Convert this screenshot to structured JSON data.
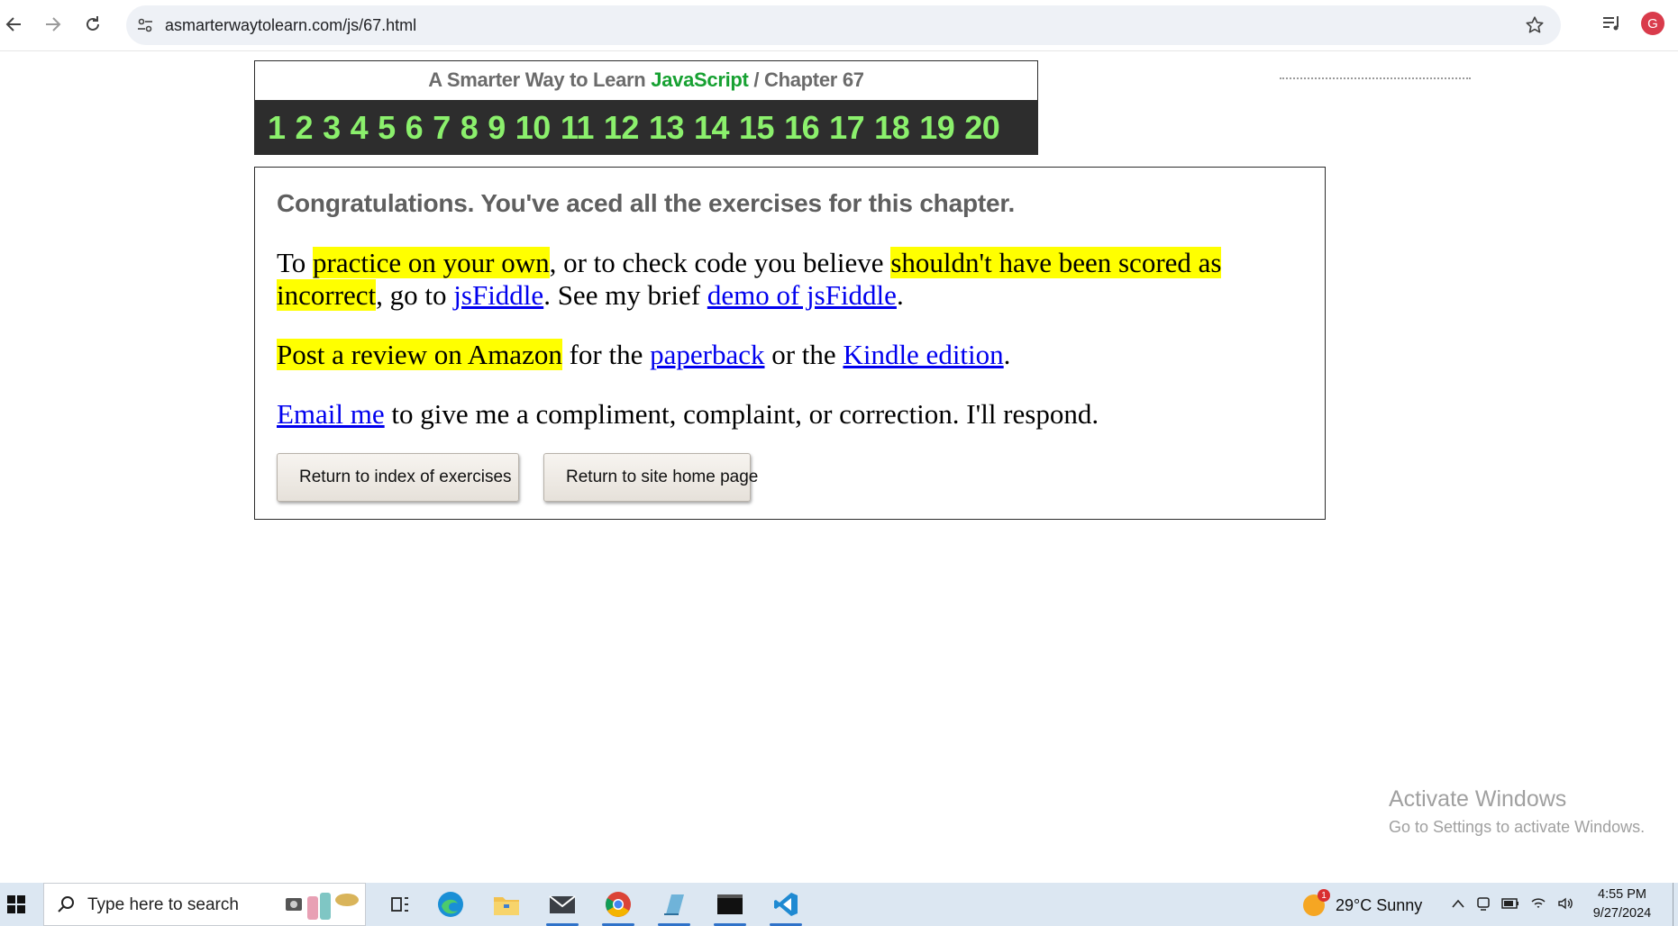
{
  "browser": {
    "url": "asmarterwaytolearn.com/js/67.html",
    "profile_initial": "G"
  },
  "header": {
    "title_prefix": "A Smarter Way to Learn ",
    "title_brand": "JavaScript",
    "title_suffix": " / Chapter 67",
    "chapters": [
      "1",
      "2",
      "3",
      "4",
      "5",
      "6",
      "7",
      "8",
      "9",
      "10",
      "11",
      "12",
      "13",
      "14",
      "15",
      "16",
      "17",
      "18",
      "19",
      "20"
    ]
  },
  "content": {
    "congrats": "Congratulations. You've aced all the exercises for this chapter.",
    "p1": {
      "t1": "To ",
      "h1": "practice on your own",
      "t2": ", or to check code you believe ",
      "h2": "shouldn't have been scored as incorrect",
      "t3": ", go to ",
      "link1": "jsFiddle",
      "t4": ". See my brief ",
      "link2": "demo of jsFiddle",
      "t5": "."
    },
    "p2": {
      "h1": "Post a review on Amazon",
      "t1": " for the ",
      "link1": "paperback",
      "t2": " or the ",
      "link2": "Kindle edition",
      "t3": "."
    },
    "p3": {
      "link1": "Email me",
      "t1": " to give me a compliment, complaint, or correction. I'll respond."
    },
    "buttons": {
      "index": "Return to index of exercises",
      "home": "Return to site home page"
    }
  },
  "watermark": {
    "line1": "Activate Windows",
    "line2": "Go to Settings to activate Windows."
  },
  "taskbar": {
    "search_placeholder": "Type here to search",
    "weather_badge": "1",
    "weather_text": "29°C  Sunny",
    "time": "4:55 PM",
    "date": "9/27/2024"
  }
}
